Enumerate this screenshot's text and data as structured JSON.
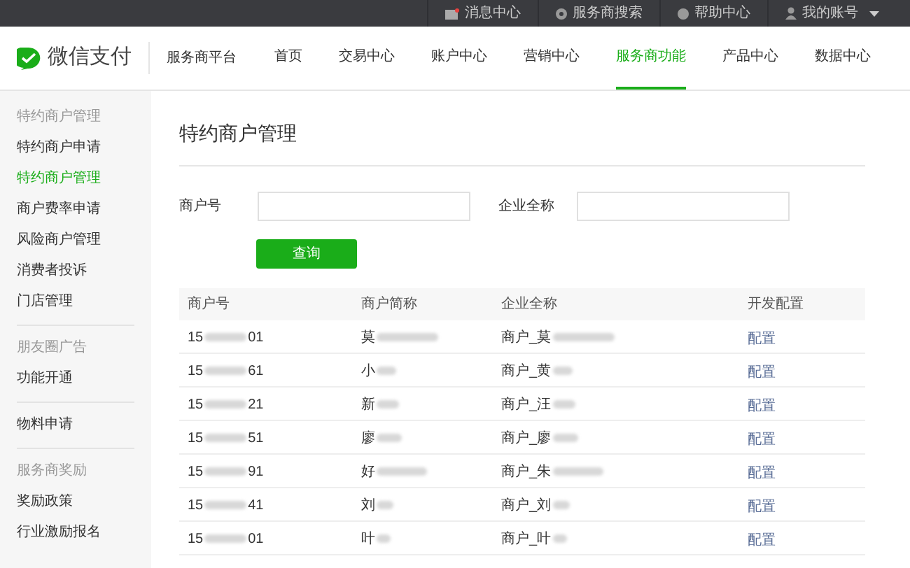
{
  "top_bar": {
    "items": [
      {
        "label": "消息中心",
        "kind": "mail"
      },
      {
        "label": "服务商搜索",
        "kind": "dot"
      },
      {
        "label": "帮助中心",
        "kind": "help"
      },
      {
        "label": "我的账号",
        "kind": "user",
        "dropdown": true
      }
    ]
  },
  "header": {
    "logo_text": "微信支付",
    "platform": "服务商平台",
    "nav": [
      {
        "label": "首页",
        "selected": false
      },
      {
        "label": "交易中心",
        "selected": false
      },
      {
        "label": "账户中心",
        "selected": false
      },
      {
        "label": "营销中心",
        "selected": false
      },
      {
        "label": "服务商功能",
        "selected": true
      },
      {
        "label": "产品中心",
        "selected": false
      },
      {
        "label": "数据中心",
        "selected": false
      }
    ]
  },
  "sidebar": {
    "groups": [
      {
        "title": "特约商户管理",
        "items": [
          {
            "label": "特约商户申请",
            "selected": false
          },
          {
            "label": "特约商户管理",
            "selected": true
          },
          {
            "label": "商户费率申请",
            "selected": false
          },
          {
            "label": "风险商户管理",
            "selected": false
          },
          {
            "label": "消费者投诉",
            "selected": false
          },
          {
            "label": "门店管理",
            "selected": false
          }
        ]
      },
      {
        "title": "朋友圈广告",
        "items": [
          {
            "label": "功能开通",
            "selected": false
          }
        ]
      },
      {
        "items": [
          {
            "label": "物料申请",
            "selected": false
          }
        ]
      },
      {
        "title": "服务商奖励",
        "items": [
          {
            "label": "奖励政策",
            "selected": false
          },
          {
            "label": "行业激励报名",
            "selected": false
          }
        ]
      }
    ]
  },
  "page_title": "特约商户管理",
  "form": {
    "fields": [
      {
        "label": "商户号"
      },
      {
        "label": "企业全称"
      }
    ],
    "button": "查询"
  },
  "table": {
    "columns": [
      "商户号",
      "商户简称",
      "企业全称",
      "开发配置"
    ],
    "rows": [
      {
        "id_start": "15",
        "id_end": "01",
        "short_name": "莫",
        "full_name": "商户_莫",
        "action": "配置"
      },
      {
        "id_start": "15",
        "id_end": "61",
        "short_name": "小",
        "full_name": "商户_黄",
        "action": "配置"
      },
      {
        "id_start": "15",
        "id_end": "21",
        "short_name": "新",
        "full_name": "商户_汪",
        "action": "配置"
      },
      {
        "id_start": "15",
        "id_end": "51",
        "short_name": "廖",
        "full_name": "商户_廖",
        "action": "配置"
      },
      {
        "id_start": "15",
        "id_end": "91",
        "short_name": "好",
        "full_name": "商户_朱",
        "action": "配置"
      },
      {
        "id_start": "15",
        "id_end": "41",
        "short_name": "刘",
        "full_name": "商户_刘",
        "action": "配置"
      },
      {
        "id_start": "15",
        "id_end": "01",
        "short_name": "叶",
        "full_name": "商户_叶",
        "action": "配置"
      }
    ]
  }
}
